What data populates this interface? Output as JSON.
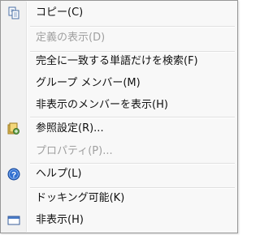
{
  "menu": {
    "items": [
      {
        "label": "コピー(C)",
        "enabled": true,
        "icon": "copy-icon"
      },
      {
        "label": "定義の表示(D)",
        "enabled": false,
        "icon": ""
      },
      {
        "label": "完全に一致する単語だけを検索(F)",
        "enabled": true,
        "icon": ""
      },
      {
        "label": "グループ メンバー(M)",
        "enabled": true,
        "icon": ""
      },
      {
        "label": "非表示のメンバーを表示(H)",
        "enabled": true,
        "icon": ""
      },
      {
        "label": "参照設定(R)...",
        "enabled": true,
        "icon": "reference-settings-icon"
      },
      {
        "label": "プロパティ(P)...",
        "enabled": false,
        "icon": ""
      },
      {
        "label": "ヘルプ(L)",
        "enabled": true,
        "icon": "help-icon"
      },
      {
        "label": "ドッキング可能(K)",
        "enabled": true,
        "icon": ""
      },
      {
        "label": "非表示(H)",
        "enabled": true,
        "icon": "window-hide-icon"
      }
    ]
  },
  "colors": {
    "menu_background": "#f8f8f8",
    "text": "#111111",
    "disabled_text": "#a0a0a0",
    "help_icon_blue": "#2f6fd0"
  }
}
